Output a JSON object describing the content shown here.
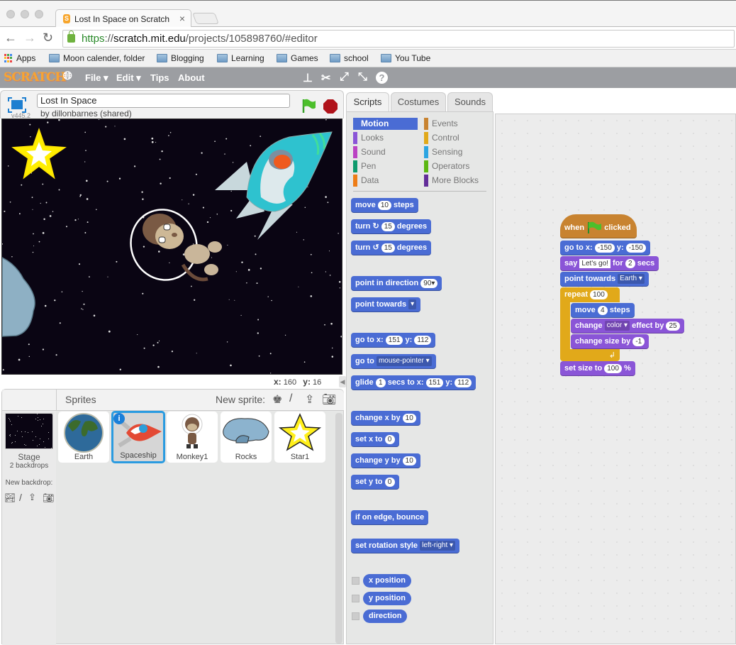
{
  "browser": {
    "tab_title": "Lost In Space on Scratch",
    "tab_favicon": "scratch-s",
    "url_scheme": "https",
    "url_sep": "://",
    "url_host": "scratch.mit.edu",
    "url_path": "/projects/105898760/#editor",
    "bookmarks": [
      {
        "label": "Apps",
        "icon": "apps-grid-icon"
      },
      {
        "label": "Moon calender, folder",
        "icon": "folder-icon"
      },
      {
        "label": "Blogging",
        "icon": "folder-icon"
      },
      {
        "label": "Learning",
        "icon": "folder-icon"
      },
      {
        "label": "Games",
        "icon": "folder-icon"
      },
      {
        "label": "school",
        "icon": "folder-icon"
      },
      {
        "label": "You Tube",
        "icon": "folder-icon"
      }
    ]
  },
  "menubar": {
    "logo": "SCRATCH",
    "items": [
      "File ▾",
      "Edit ▾",
      "Tips",
      "About"
    ]
  },
  "stage": {
    "project_title": "Lost In Space",
    "byline": "by dillonbarnes (shared)",
    "version": "v445.2",
    "mouse_x_label": "x:",
    "mouse_x": "160",
    "mouse_y_label": "y:",
    "mouse_y": "16"
  },
  "sprites_pane": {
    "header": "Sprites",
    "new_sprite_label": "New sprite:",
    "stage_label": "Stage",
    "stage_backdrops": "2 backdrops",
    "new_backdrop_label": "New backdrop:",
    "sprites": [
      {
        "name": "Earth",
        "selected": false
      },
      {
        "name": "Spaceship",
        "selected": true
      },
      {
        "name": "Monkey1",
        "selected": false
      },
      {
        "name": "Rocks",
        "selected": false
      },
      {
        "name": "Star1",
        "selected": false
      }
    ]
  },
  "tabs": [
    "Scripts",
    "Costumes",
    "Sounds"
  ],
  "active_tab": "Scripts",
  "categories": [
    {
      "label": "Motion",
      "color": "#4a6cd4",
      "selected": true
    },
    {
      "label": "Events",
      "color": "#c88330"
    },
    {
      "label": "Looks",
      "color": "#8a55d7"
    },
    {
      "label": "Control",
      "color": "#e1a91a"
    },
    {
      "label": "Sound",
      "color": "#bb42c3"
    },
    {
      "label": "Sensing",
      "color": "#2ca5e2"
    },
    {
      "label": "Pen",
      "color": "#0e9a6c"
    },
    {
      "label": "Operators",
      "color": "#5cb712"
    },
    {
      "label": "Data",
      "color": "#ee7d16"
    },
    {
      "label": "More Blocks",
      "color": "#632d99"
    }
  ],
  "palette_blocks": {
    "move": {
      "w1": "move",
      "v": "10",
      "w2": "steps"
    },
    "turn_cw": {
      "w1": "turn",
      "v": "15",
      "w2": "degrees"
    },
    "turn_ccw": {
      "w1": "turn",
      "v": "15",
      "w2": "degrees"
    },
    "point_dir": {
      "w1": "point in direction",
      "v": "90▾"
    },
    "point_towards": {
      "w1": "point towards",
      "v": "▾"
    },
    "goto_xy": {
      "w1": "go to x:",
      "x": "151",
      "w2": "y:",
      "y": "112"
    },
    "goto": {
      "w1": "go to",
      "v": "mouse-pointer ▾"
    },
    "glide": {
      "w1": "glide",
      "v": "1",
      "w2": "secs to x:",
      "x": "151",
      "w3": "y:",
      "y": "112"
    },
    "change_x": {
      "w1": "change x by",
      "v": "10"
    },
    "set_x": {
      "w1": "set x to",
      "v": "0"
    },
    "change_y": {
      "w1": "change y by",
      "v": "10"
    },
    "set_y": {
      "w1": "set y to",
      "v": "0"
    },
    "bounce": {
      "w1": "if on edge, bounce"
    },
    "rotation": {
      "w1": "set rotation style",
      "v": "left-right ▾"
    },
    "reporters": [
      "x position",
      "y position",
      "direction"
    ]
  },
  "script": {
    "hat": {
      "w1": "when",
      "w2": "clicked"
    },
    "goto": {
      "w1": "go to x:",
      "x": "-150",
      "w2": "y:",
      "y": "-150"
    },
    "say": {
      "w1": "say",
      "v": "Let's go!",
      "w2": "for",
      "n": "2",
      "w3": "secs"
    },
    "point": {
      "w1": "point towards",
      "v": "Earth ▾"
    },
    "repeat": {
      "w1": "repeat",
      "v": "100"
    },
    "move": {
      "w1": "move",
      "v": "4",
      "w2": "steps"
    },
    "effect": {
      "w1": "change",
      "v": "color ▾",
      "w2": "effect by",
      "n": "25"
    },
    "size": {
      "w1": "change size by",
      "v": "-1"
    },
    "setsize": {
      "w1": "set size to",
      "v": "100",
      "w2": "%"
    }
  }
}
